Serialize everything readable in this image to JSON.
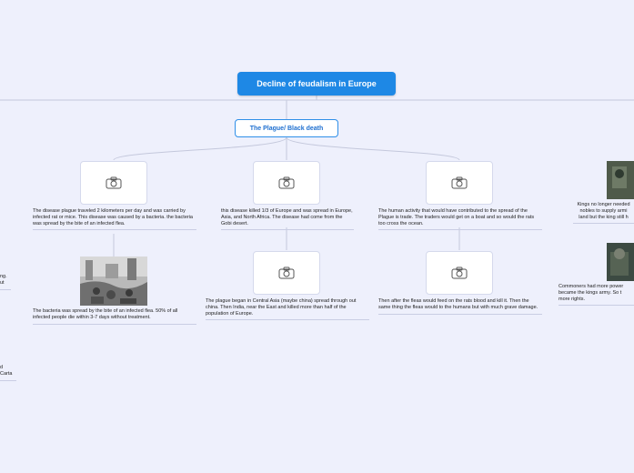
{
  "root": {
    "title": "Decline of feudalism in Europe"
  },
  "sub": {
    "title": "The Plague/ Black death"
  },
  "branches": [
    {
      "top": "The disease plague traveled 2 kilometers per day and was carried by infected rat or mice. This disease was caused by a bacteria. the bacteria was spread by the bite of an infected flea.",
      "bottom": "The bacteria was spread by the bite of an infected flea. 50% of all infected people die within 3-7 days without treatment."
    },
    {
      "top": "this disease killed 1/3 of Europe and was spread in Europe, Asia, and North Africa. The disease had come from the Gobi desert.",
      "bottom": "The plague began in Central Asia (maybe china) spread through out china. Then India, near the East and killed more than half of the population of Europe."
    },
    {
      "top": "The human activity that would have contributed to the spread of the Plague is trade. The traders would get on a boat and so would the rats too cross the ocean.",
      "bottom": "Then after the fleas would feed on the rats blood and kill it. Then the same thing the fleas would to the humans but with much grave damage."
    }
  ],
  "right": [
    {
      "lines": [
        "Kings no longer needed",
        "nobles to supply armi",
        "land but the king still h"
      ]
    },
    {
      "lines": [
        "Commoners had more power",
        "became the kings army. So t",
        "more rights."
      ]
    }
  ],
  "left": [
    {
      "lines": [
        "ng.",
        "ut"
      ]
    },
    {
      "lines": [
        "d",
        "Carta"
      ]
    }
  ],
  "icons": {
    "placeholder": "camera-icon"
  },
  "colors": {
    "background": "#eef0fc",
    "root": "#1e88e5",
    "sub_border": "#2f8fe8",
    "line": "#c4c8dc"
  }
}
